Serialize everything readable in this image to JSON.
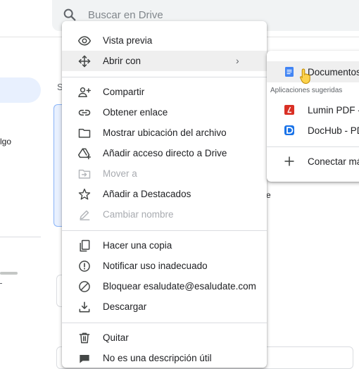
{
  "search": {
    "placeholder": "Buscar en Drive",
    "icon": "search-icon"
  },
  "background": {
    "sidebar_text": "lgo",
    "section_letter": "S",
    "partial_letter": "e"
  },
  "context_menu": {
    "items": [
      {
        "label": "Vista previa",
        "icon": "eye-icon",
        "disabled": false
      },
      {
        "label": "Abrir con",
        "icon": "move-arrows-icon",
        "disabled": false,
        "has_submenu": true,
        "submenu_arrow": "›"
      },
      {
        "label": "Compartir",
        "icon": "person-add-icon",
        "disabled": false
      },
      {
        "label": "Obtener enlace",
        "icon": "link-icon",
        "disabled": false
      },
      {
        "label": "Mostrar ubicación del archivo",
        "icon": "folder-icon",
        "disabled": false
      },
      {
        "label": "Añadir acceso directo a Drive",
        "icon": "drive-shortcut-icon",
        "disabled": false
      },
      {
        "label": "Mover a",
        "icon": "move-to-icon",
        "disabled": true
      },
      {
        "label": "Añadir a Destacados",
        "icon": "star-icon",
        "disabled": false
      },
      {
        "label": "Cambiar nombre",
        "icon": "pencil-icon",
        "disabled": true
      },
      {
        "label": "Hacer una copia",
        "icon": "copy-icon",
        "disabled": false
      },
      {
        "label": "Notificar uso inadecuado",
        "icon": "alert-icon",
        "disabled": false
      },
      {
        "label": "Bloquear esaludate@esaludate.com",
        "icon": "block-icon",
        "disabled": false
      },
      {
        "label": "Descargar",
        "icon": "download-icon",
        "disabled": false
      },
      {
        "label": "Quitar",
        "icon": "trash-icon",
        "disabled": false
      },
      {
        "label": "No es una descripción útil",
        "icon": "feedback-icon",
        "disabled": false
      }
    ]
  },
  "submenu": {
    "primary": {
      "label": "Documentos",
      "icon": "google-docs-icon"
    },
    "caption": "Aplicaciones sugeridas",
    "apps": [
      {
        "label": "Lumin PDF - l",
        "icon": "lumin-pdf-icon",
        "color": "#d93025"
      },
      {
        "label": "DocHub - PD",
        "icon": "dochub-icon",
        "color": "#1a73e8"
      }
    ],
    "connect": {
      "label": "Conectar má",
      "icon": "plus-icon"
    }
  },
  "colors": {
    "docs_blue": "#4285f4",
    "highlight": "#efefef",
    "cursor_yellow": "#fcd34d"
  }
}
